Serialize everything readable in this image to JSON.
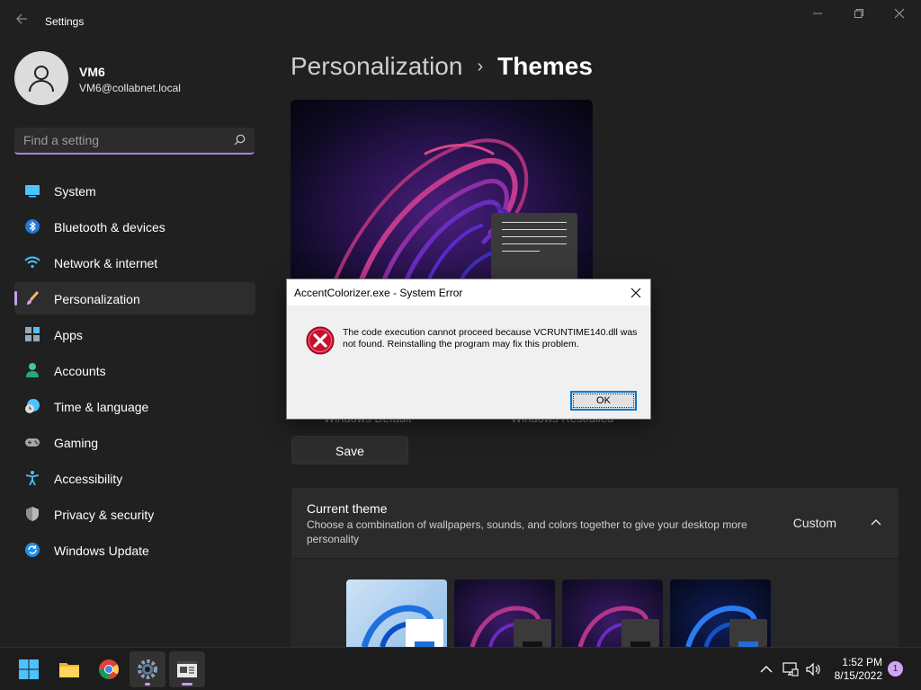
{
  "window": {
    "title": "Settings",
    "back_icon": "back-arrow-icon",
    "minimize_icon": "minimize-icon",
    "maximize_icon": "restore-icon",
    "close_icon": "close-icon"
  },
  "profile": {
    "name": "VM6",
    "email": "VM6@collabnet.local"
  },
  "search": {
    "placeholder": "Find a setting",
    "icon": "search-icon"
  },
  "sidebar": {
    "items": [
      {
        "label": "System",
        "icon": "system-icon"
      },
      {
        "label": "Bluetooth & devices",
        "icon": "bluetooth-icon"
      },
      {
        "label": "Network & internet",
        "icon": "wifi-icon"
      },
      {
        "label": "Personalization",
        "icon": "brush-icon",
        "active": true
      },
      {
        "label": "Apps",
        "icon": "apps-icon"
      },
      {
        "label": "Accounts",
        "icon": "accounts-icon"
      },
      {
        "label": "Time & language",
        "icon": "globe-clock-icon"
      },
      {
        "label": "Gaming",
        "icon": "gamepad-icon"
      },
      {
        "label": "Accessibility",
        "icon": "accessibility-icon"
      },
      {
        "label": "Privacy & security",
        "icon": "shield-icon"
      },
      {
        "label": "Windows Update",
        "icon": "update-icon"
      }
    ]
  },
  "breadcrumb": {
    "parent": "Personalization",
    "separator": "›",
    "current": "Themes"
  },
  "theme_names": {
    "left": "Windows Default",
    "right": "Windows Restfulled"
  },
  "save_label": "Save",
  "current_theme": {
    "title": "Current theme",
    "description": "Choose a combination of wallpapers, sounds, and colors together to give your desktop more personality",
    "value": "Custom",
    "chevron_icon": "chevron-up-icon"
  },
  "dialog": {
    "title": "AccentColorizer.exe - System Error",
    "message": "The code execution cannot proceed because VCRUNTIME140.dll was not found. Reinstalling the program may fix this problem.",
    "ok_label": "OK",
    "icon": "error-icon"
  },
  "taskbar": {
    "apps": [
      "start-icon",
      "file-explorer-icon",
      "chrome-icon",
      "settings-icon",
      "news-app-icon"
    ],
    "tray": [
      "chevron-up-icon",
      "network-icon",
      "volume-icon"
    ],
    "time": "1:52 PM",
    "date": "8/15/2022",
    "notification_count": "1"
  },
  "colors": {
    "accent": "#c79cf6",
    "background": "#202020",
    "card": "#2b2b2b",
    "error_red": "#c8102e"
  }
}
